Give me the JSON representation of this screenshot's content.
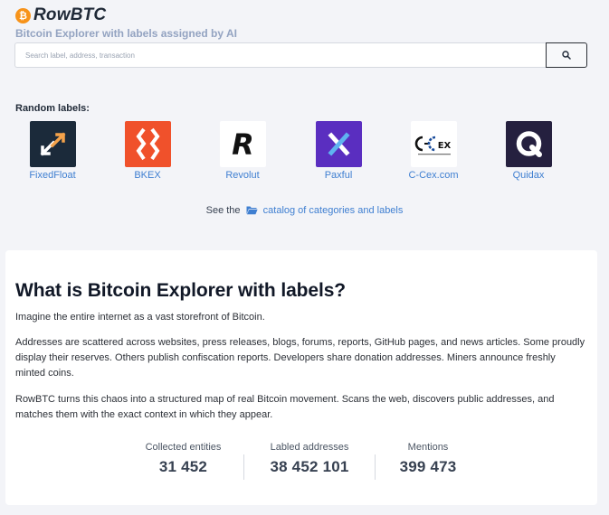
{
  "header": {
    "brand": "RowBTC",
    "tagline": "Bitcoin Explorer with labels assigned by AI"
  },
  "search": {
    "placeholder": "Search label, address, transaction",
    "button_icon": "search-icon"
  },
  "random_labels": {
    "title": "Random labels:",
    "items": [
      {
        "name": "FixedFloat",
        "icon": "fixedfloat-logo",
        "color": "#1b2a3a"
      },
      {
        "name": "BKEX",
        "icon": "bkex-logo",
        "color": "#f0512b"
      },
      {
        "name": "Revolut",
        "icon": "revolut-logo",
        "color": "#ffffff"
      },
      {
        "name": "Paxful",
        "icon": "paxful-logo",
        "color": "#5a2ec0"
      },
      {
        "name": "C-Cex.com",
        "icon": "ccex-logo",
        "color": "#ffffff"
      },
      {
        "name": "Quidax",
        "icon": "quidax-logo",
        "color": "#25203f"
      }
    ]
  },
  "catalog": {
    "prefix": "See the",
    "link": "catalog of categories and labels",
    "icon": "folder-icon"
  },
  "about": {
    "title": "What is Bitcoin Explorer with labels?",
    "p1": "Imagine the entire internet as a vast storefront of Bitcoin.",
    "p2": "Addresses are scattered across websites, press releases, blogs, forums, reports, GitHub pages, and news articles. Some proudly display their reserves. Others publish confiscation reports. Developers share donation addresses. Miners announce freshly minted coins.",
    "p3": "RowBTC turns this chaos into a structured map of real Bitcoin movement. Scans the web, discovers public addresses, and matches them with the exact context in which they appear."
  },
  "stats": [
    {
      "label": "Collected entities",
      "value": "31 452"
    },
    {
      "label": "Labled addresses",
      "value": "38 452 101"
    },
    {
      "label": "Mentions",
      "value": "399 473"
    }
  ],
  "colors": {
    "accent": "#f7931a",
    "link": "#3f7fd1",
    "background": "#f3f4f8"
  }
}
